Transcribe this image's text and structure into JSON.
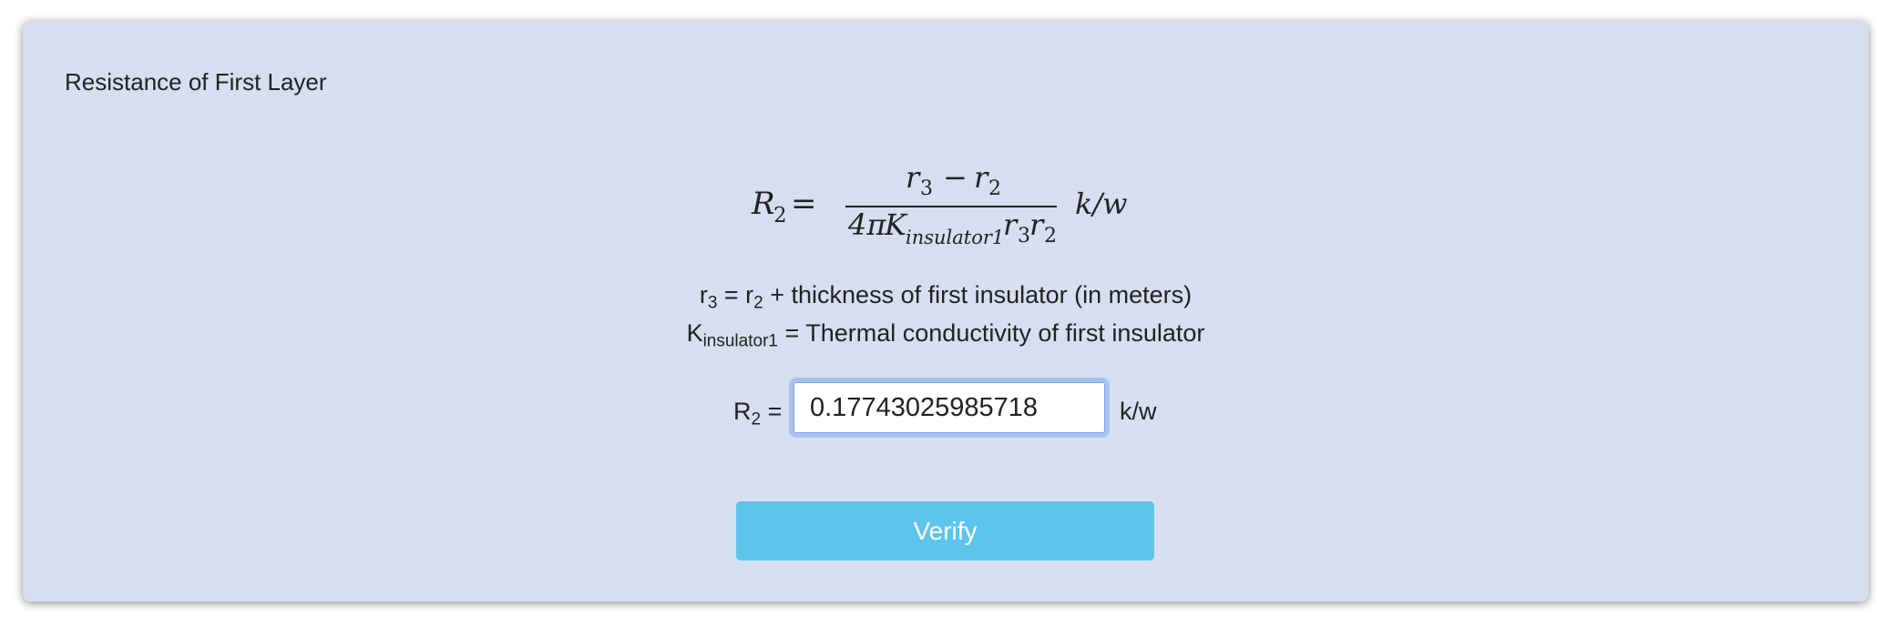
{
  "card": {
    "title": "Resistance of First Layer"
  },
  "formula": {
    "lhs_symbol": "R",
    "lhs_subscript": "2",
    "equals": "=",
    "numerator": {
      "a": "r",
      "a_sub": "3",
      "minus": "−",
      "b": "r",
      "b_sub": "2"
    },
    "denominator": {
      "coefficient": "4π",
      "k": "K",
      "k_sub": "insulator1",
      "r3": "r",
      "r3_sub": "3",
      "r2": "r",
      "r2_sub": "2"
    },
    "unit": "k/w"
  },
  "definitions": {
    "line1": {
      "a": "r",
      "a_sub": "3",
      "mid": " = r",
      "b_sub": "2",
      "rest": " + thickness of first insulator (in meters)"
    },
    "line2": {
      "a": "K",
      "a_sub": "insulator1",
      "rest": " = Thermal conductivity of first insulator"
    }
  },
  "answer": {
    "label": "R",
    "label_sub": "2",
    "label_eq": " =",
    "value": "0.17743025985718",
    "unit": "k/w"
  },
  "verify_button": {
    "label": "Verify",
    "color": "#5dc5ec"
  },
  "colors": {
    "card_background": "#d6dff0",
    "input_focus_border": "#a9c0f0"
  }
}
